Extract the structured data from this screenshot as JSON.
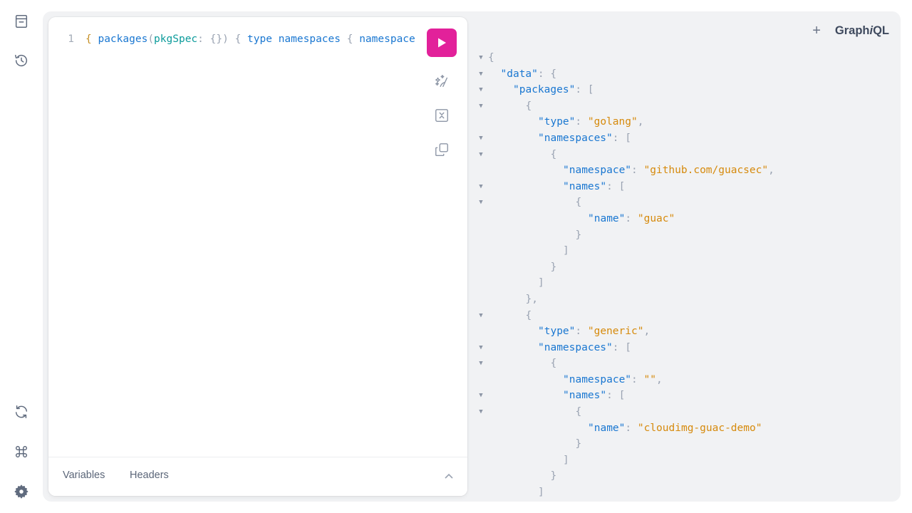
{
  "sidebar": {
    "icons": [
      "docs-icon",
      "history-icon",
      "refetch-schema-icon",
      "shortcuts-icon",
      "settings-icon"
    ]
  },
  "editor": {
    "line_number": "1",
    "tokens": [
      {
        "t": "{",
        "c": "brace"
      },
      {
        "t": " ",
        "c": "sp"
      },
      {
        "t": "packages",
        "c": "field"
      },
      {
        "t": "(",
        "c": "punct"
      },
      {
        "t": "pkgSpec",
        "c": "arg"
      },
      {
        "t": ": ",
        "c": "punct"
      },
      {
        "t": "{}",
        "c": "punct"
      },
      {
        "t": ")",
        "c": "punct"
      },
      {
        "t": " ",
        "c": "sp"
      },
      {
        "t": "{",
        "c": "punct"
      },
      {
        "t": " ",
        "c": "sp"
      },
      {
        "t": "type",
        "c": "field"
      },
      {
        "t": " ",
        "c": "sp"
      },
      {
        "t": "namespaces",
        "c": "field"
      },
      {
        "t": " ",
        "c": "sp"
      },
      {
        "t": "{",
        "c": "punct"
      },
      {
        "t": " ",
        "c": "sp"
      },
      {
        "t": "namespace",
        "c": "field"
      }
    ],
    "tools": [
      "execute-query",
      "prettify",
      "merge-fragments",
      "copy-query"
    ]
  },
  "bottom": {
    "variables_label": "Variables",
    "headers_label": "Headers"
  },
  "header": {
    "plus": "+",
    "logo_prefix": "Graph",
    "logo_italic": "i",
    "logo_suffix": "QL"
  },
  "response_lines": [
    {
      "fold": true,
      "i": 0,
      "p": [
        [
          "{",
          "p"
        ]
      ]
    },
    {
      "fold": true,
      "i": 1,
      "p": [
        [
          "\"data\"",
          "k"
        ],
        [
          ": {",
          "p"
        ]
      ]
    },
    {
      "fold": true,
      "i": 2,
      "p": [
        [
          "\"packages\"",
          "k"
        ],
        [
          ": [",
          "p"
        ]
      ]
    },
    {
      "fold": true,
      "i": 3,
      "p": [
        [
          "{",
          "p"
        ]
      ]
    },
    {
      "fold": false,
      "i": 4,
      "p": [
        [
          "\"type\"",
          "k"
        ],
        [
          ": ",
          "p"
        ],
        [
          "\"golang\"",
          "s"
        ],
        [
          ",",
          "p"
        ]
      ]
    },
    {
      "fold": true,
      "i": 4,
      "p": [
        [
          "\"namespaces\"",
          "k"
        ],
        [
          ": [",
          "p"
        ]
      ]
    },
    {
      "fold": true,
      "i": 5,
      "p": [
        [
          "{",
          "p"
        ]
      ]
    },
    {
      "fold": false,
      "i": 6,
      "p": [
        [
          "\"namespace\"",
          "k"
        ],
        [
          ": ",
          "p"
        ],
        [
          "\"github.com/guacsec\"",
          "s"
        ],
        [
          ",",
          "p"
        ]
      ]
    },
    {
      "fold": true,
      "i": 6,
      "p": [
        [
          "\"names\"",
          "k"
        ],
        [
          ": [",
          "p"
        ]
      ]
    },
    {
      "fold": true,
      "i": 7,
      "p": [
        [
          "{",
          "p"
        ]
      ]
    },
    {
      "fold": false,
      "i": 8,
      "p": [
        [
          "\"name\"",
          "k"
        ],
        [
          ": ",
          "p"
        ],
        [
          "\"guac\"",
          "s"
        ]
      ]
    },
    {
      "fold": false,
      "i": 7,
      "p": [
        [
          "}",
          "p"
        ]
      ]
    },
    {
      "fold": false,
      "i": 6,
      "p": [
        [
          "]",
          "p"
        ]
      ]
    },
    {
      "fold": false,
      "i": 5,
      "p": [
        [
          "}",
          "p"
        ]
      ]
    },
    {
      "fold": false,
      "i": 4,
      "p": [
        [
          "]",
          "p"
        ]
      ]
    },
    {
      "fold": false,
      "i": 3,
      "p": [
        [
          "},",
          "p"
        ]
      ]
    },
    {
      "fold": true,
      "i": 3,
      "p": [
        [
          "{",
          "p"
        ]
      ]
    },
    {
      "fold": false,
      "i": 4,
      "p": [
        [
          "\"type\"",
          "k"
        ],
        [
          ": ",
          "p"
        ],
        [
          "\"generic\"",
          "s"
        ],
        [
          ",",
          "p"
        ]
      ]
    },
    {
      "fold": true,
      "i": 4,
      "p": [
        [
          "\"namespaces\"",
          "k"
        ],
        [
          ": [",
          "p"
        ]
      ]
    },
    {
      "fold": true,
      "i": 5,
      "p": [
        [
          "{",
          "p"
        ]
      ]
    },
    {
      "fold": false,
      "i": 6,
      "p": [
        [
          "\"namespace\"",
          "k"
        ],
        [
          ": ",
          "p"
        ],
        [
          "\"\"",
          "s"
        ],
        [
          ",",
          "p"
        ]
      ]
    },
    {
      "fold": true,
      "i": 6,
      "p": [
        [
          "\"names\"",
          "k"
        ],
        [
          ": [",
          "p"
        ]
      ]
    },
    {
      "fold": true,
      "i": 7,
      "p": [
        [
          "{",
          "p"
        ]
      ]
    },
    {
      "fold": false,
      "i": 8,
      "p": [
        [
          "\"name\"",
          "k"
        ],
        [
          ": ",
          "p"
        ],
        [
          "\"cloudimg-guac-demo\"",
          "s"
        ]
      ]
    },
    {
      "fold": false,
      "i": 7,
      "p": [
        [
          "}",
          "p"
        ]
      ]
    },
    {
      "fold": false,
      "i": 6,
      "p": [
        [
          "]",
          "p"
        ]
      ]
    },
    {
      "fold": false,
      "i": 5,
      "p": [
        [
          "}",
          "p"
        ]
      ]
    },
    {
      "fold": false,
      "i": 4,
      "p": [
        [
          "]",
          "p"
        ]
      ]
    }
  ],
  "colors": {
    "run_button": "#e2219a",
    "json_key": "#1a77d1",
    "json_string": "#d68a0c",
    "brace": "#c69026",
    "arg": "#0c9b9b"
  }
}
